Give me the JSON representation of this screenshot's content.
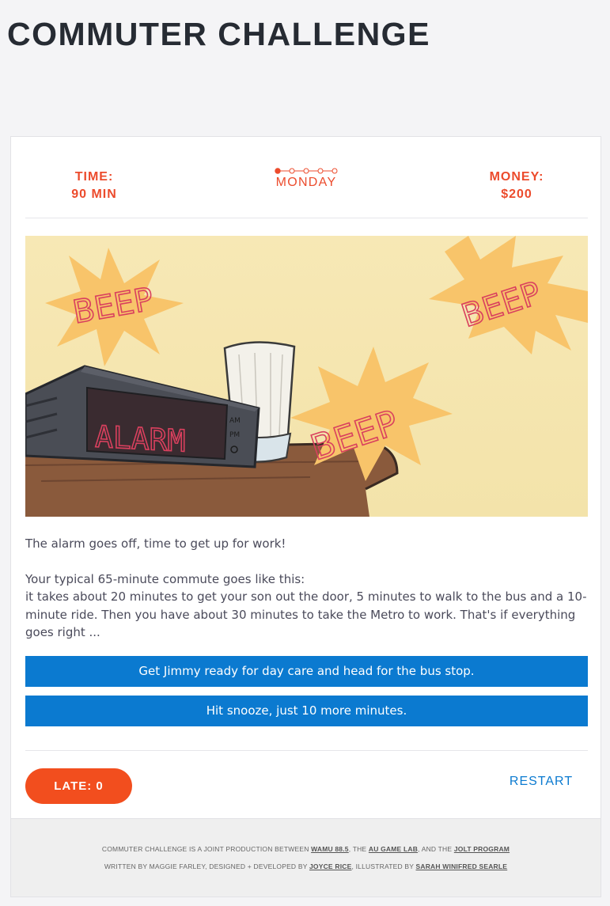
{
  "page": {
    "title": "COMMUTER CHALLENGE"
  },
  "stats": {
    "time_label": "TIME:",
    "time_value": "90 MIN",
    "day": "MONDAY",
    "day_progress": {
      "current": 1,
      "total": 5
    },
    "money_label": "MONEY:",
    "money_value": "$200"
  },
  "scene": {
    "beep_1": "BEEP",
    "beep_2": "BEEP",
    "beep_3": "BEEP",
    "clock_display": "ALARM",
    "clock_am": "AM",
    "clock_pm": "PM"
  },
  "story": {
    "line1": "The alarm goes off, time to get up for work!",
    "line2": "Your typical 65-minute commute goes like this:",
    "line3": "it takes about 20 minutes to get your son out the door, 5 minutes to walk to the bus and a 10-minute ride. Then you have about 30 minutes to take the Metro to work. That's if everything goes right ..."
  },
  "choices": [
    "Get Jimmy ready for day care and head for the bus stop.",
    "Hit snooze, just 10 more minutes."
  ],
  "controls": {
    "late_label": "LATE: 0",
    "restart_label": "RESTART"
  },
  "footer": {
    "l1_a": "COMMUTER CHALLENGE IS A JOINT PRODUCTION BETWEEN ",
    "l1_link1": "WAMU 88.5",
    "l1_b": ", THE ",
    "l1_link2": "AU GAME LAB",
    "l1_c": ", AND THE ",
    "l1_link3": "JOLT PROGRAM",
    "l2_a": "WRITTEN BY MAGGIE FARLEY, DESIGNED + DEVELOPED BY ",
    "l2_link1": "JOYCE RICE",
    "l2_b": ", ILLUSTRATED BY ",
    "l2_link2": "SARAH WINIFRED SEARLE"
  },
  "colors": {
    "accent_orange": "#ec4b2c",
    "button_blue": "#0b7ad0",
    "late_button": "#f24e1e"
  }
}
